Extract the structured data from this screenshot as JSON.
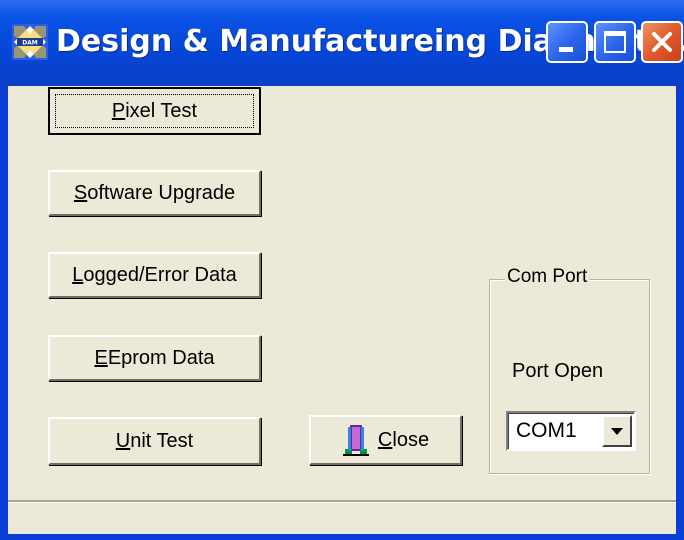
{
  "window": {
    "title": "Design & Manufactureing Diagnostic...",
    "icon": "app-logo-icon",
    "controls": [
      "minimize-icon",
      "maximize-icon",
      "close-icon"
    ]
  },
  "buttons": {
    "pixel_test": {
      "mnemonic": "P",
      "rest": "ixel Test",
      "focused": true
    },
    "software_upgrade": {
      "mnemonic": "S",
      "rest": "oftware Upgrade"
    },
    "logged_error": {
      "mnemonic": "L",
      "rest": "ogged/Error Data"
    },
    "eeprom": {
      "mnemonic": "E",
      "rest": "Eprom Data"
    },
    "unit_test": {
      "mnemonic": "U",
      "rest": "nit Test"
    },
    "close": {
      "mnemonic": "C",
      "rest": "lose",
      "icon": "door-exit-icon"
    }
  },
  "com_port": {
    "group_label": "Com Port",
    "port_open_label": "Port Open",
    "selected": "COM1"
  },
  "colors": {
    "titlebar": "#0546d8",
    "face": "#ece9d8",
    "close_button": "#e15a2a"
  }
}
